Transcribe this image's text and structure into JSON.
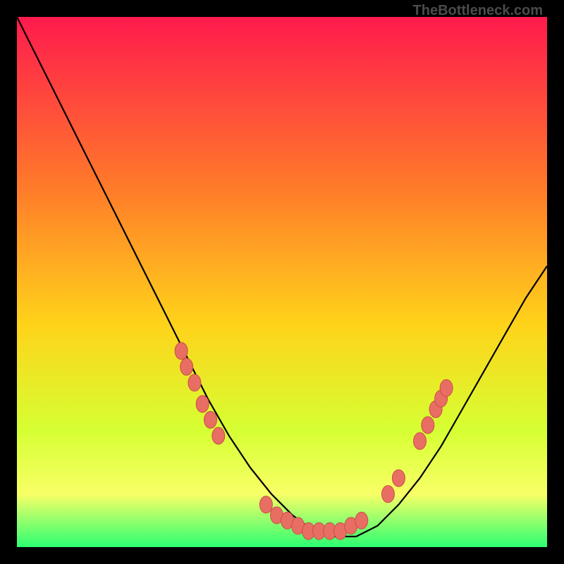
{
  "watermark": "TheBottleneck.com",
  "colors": {
    "bg_black": "#000000",
    "grad_top": "#ff1a4d",
    "grad_upper_mid": "#ff7a2a",
    "grad_mid": "#ffd31a",
    "grad_lower_mid": "#d6ff33",
    "grad_band_yellow": "#f8ff66",
    "grad_bottom": "#2cff72",
    "curve": "#000000",
    "marker_fill": "#e86e63",
    "marker_stroke": "#c94f46"
  },
  "chart_data": {
    "type": "line",
    "title": "",
    "xlabel": "",
    "ylabel": "",
    "xlim": [
      0,
      100
    ],
    "ylim": [
      0,
      100
    ],
    "grid": false,
    "legend": false,
    "annotations": [
      "TheBottleneck.com"
    ],
    "series": [
      {
        "name": "bottleneck-curve",
        "x": [
          0,
          6,
          12,
          18,
          24,
          28,
          32,
          36,
          40,
          44,
          48,
          52,
          56,
          60,
          64,
          68,
          72,
          76,
          80,
          84,
          88,
          92,
          96,
          100
        ],
        "values": [
          100,
          88,
          76,
          64,
          52,
          44,
          36,
          28,
          21,
          15,
          10,
          6,
          3,
          2,
          2,
          4,
          8,
          13,
          19,
          26,
          33,
          40,
          47,
          53
        ]
      }
    ],
    "markers": [
      {
        "x": 31,
        "y": 37
      },
      {
        "x": 32,
        "y": 34
      },
      {
        "x": 33.5,
        "y": 31
      },
      {
        "x": 35,
        "y": 27
      },
      {
        "x": 36.5,
        "y": 24
      },
      {
        "x": 38,
        "y": 21
      },
      {
        "x": 47,
        "y": 8
      },
      {
        "x": 49,
        "y": 6
      },
      {
        "x": 51,
        "y": 5
      },
      {
        "x": 53,
        "y": 4
      },
      {
        "x": 55,
        "y": 3
      },
      {
        "x": 57,
        "y": 3
      },
      {
        "x": 59,
        "y": 3
      },
      {
        "x": 61,
        "y": 3
      },
      {
        "x": 63,
        "y": 4
      },
      {
        "x": 65,
        "y": 5
      },
      {
        "x": 70,
        "y": 10
      },
      {
        "x": 72,
        "y": 13
      },
      {
        "x": 76,
        "y": 20
      },
      {
        "x": 77.5,
        "y": 23
      },
      {
        "x": 79,
        "y": 26
      },
      {
        "x": 80,
        "y": 28
      },
      {
        "x": 81,
        "y": 30
      }
    ]
  }
}
